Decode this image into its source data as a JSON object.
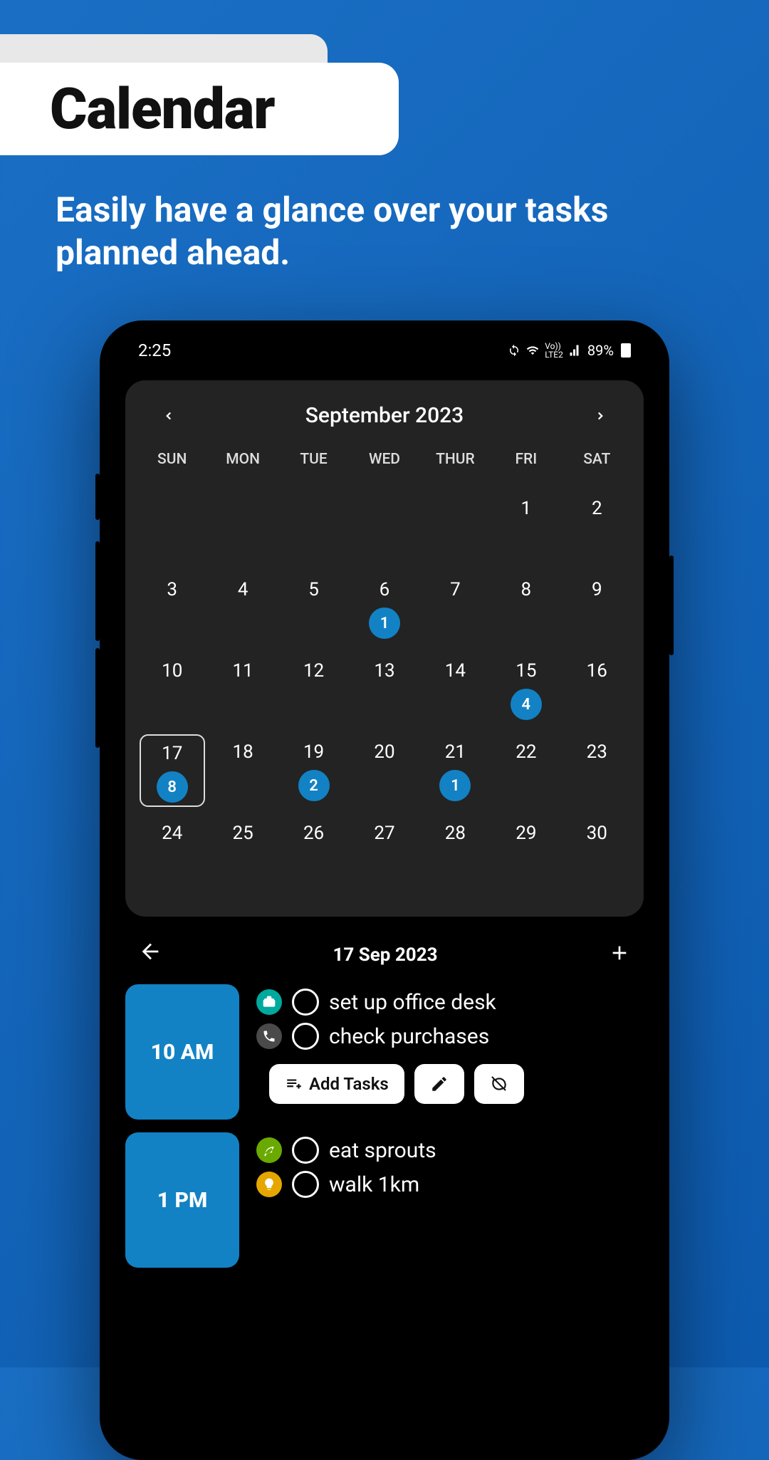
{
  "marketing": {
    "title": "Calendar",
    "subtitle": "Easily have a glance over your tasks planned ahead."
  },
  "status": {
    "time": "2:25",
    "network": "LTE2",
    "battery_pct": "89%"
  },
  "calendar": {
    "month_label": "September 2023",
    "dow": [
      "SUN",
      "MON",
      "TUE",
      "WED",
      "THUR",
      "FRI",
      "SAT"
    ],
    "cells": [
      {
        "d": "",
        "b": null
      },
      {
        "d": "",
        "b": null
      },
      {
        "d": "",
        "b": null
      },
      {
        "d": "",
        "b": null
      },
      {
        "d": "",
        "b": null
      },
      {
        "d": "1",
        "b": null
      },
      {
        "d": "2",
        "b": null
      },
      {
        "d": "3",
        "b": null
      },
      {
        "d": "4",
        "b": null
      },
      {
        "d": "5",
        "b": null
      },
      {
        "d": "6",
        "b": "1"
      },
      {
        "d": "7",
        "b": null
      },
      {
        "d": "8",
        "b": null
      },
      {
        "d": "9",
        "b": null
      },
      {
        "d": "10",
        "b": null
      },
      {
        "d": "11",
        "b": null
      },
      {
        "d": "12",
        "b": null
      },
      {
        "d": "13",
        "b": null
      },
      {
        "d": "14",
        "b": null
      },
      {
        "d": "15",
        "b": "4"
      },
      {
        "d": "16",
        "b": null
      },
      {
        "d": "17",
        "b": "8",
        "sel": true
      },
      {
        "d": "18",
        "b": null
      },
      {
        "d": "19",
        "b": "2"
      },
      {
        "d": "20",
        "b": null
      },
      {
        "d": "21",
        "b": "1"
      },
      {
        "d": "22",
        "b": null
      },
      {
        "d": "23",
        "b": null
      },
      {
        "d": "24",
        "b": null
      },
      {
        "d": "25",
        "b": null
      },
      {
        "d": "26",
        "b": null
      },
      {
        "d": "27",
        "b": null
      },
      {
        "d": "28",
        "b": null
      },
      {
        "d": "29",
        "b": null
      },
      {
        "d": "30",
        "b": null
      }
    ]
  },
  "day": {
    "title": "17 Sep 2023",
    "add_tasks_label": "Add Tasks",
    "slots": [
      {
        "time": "10 AM",
        "tasks": [
          {
            "cat_color": "#00a99d",
            "icon": "briefcase",
            "label": "set up office desk"
          },
          {
            "cat_color": "#4a4a4a",
            "icon": "phone",
            "label": "check purchases"
          }
        ],
        "show_actions": true
      },
      {
        "time": "1 PM",
        "tasks": [
          {
            "cat_color": "#6aaa00",
            "icon": "leaf",
            "label": "eat sprouts"
          },
          {
            "cat_color": "#e5a600",
            "icon": "bulb",
            "label": "walk 1km"
          }
        ],
        "show_actions": false
      }
    ]
  }
}
